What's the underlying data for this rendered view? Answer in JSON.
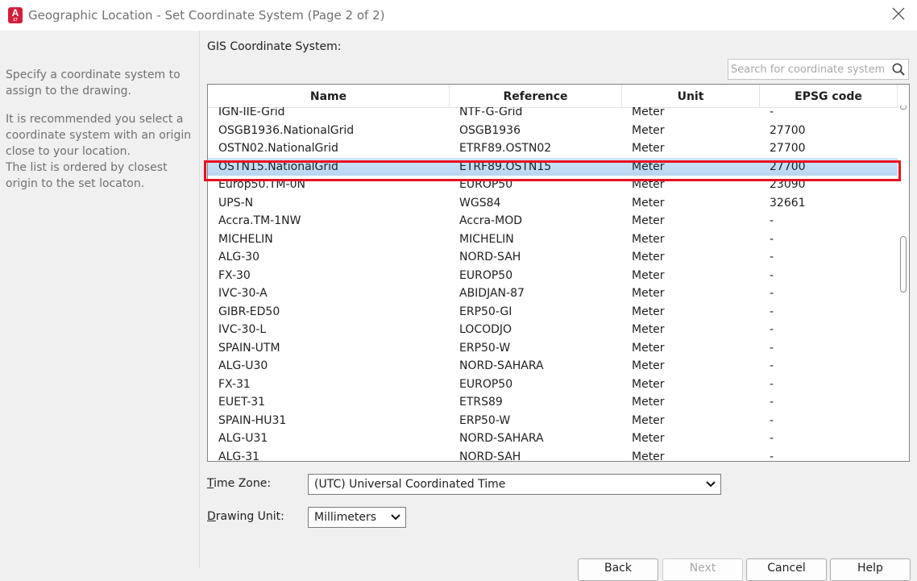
{
  "window": {
    "title": "Geographic Location - Set Coordinate System (Page 2 of 2)",
    "app_icon_letter": "A",
    "app_icon_sub": "17"
  },
  "help": {
    "p1": "Specify a coordinate system to assign to the drawing.",
    "p2": "It is recommended you select a coordinate system with an origin close to your location.",
    "p3": "The list is ordered by closest origin to the set locaton."
  },
  "gis": {
    "label": "GIS Coordinate System:",
    "search_placeholder": "Search for coordinate system"
  },
  "table": {
    "columns": [
      "Name",
      "Reference",
      "Unit",
      "EPSG code"
    ],
    "selected_index": 3,
    "rows": [
      [
        "IGN-IIE-Grid",
        "NTF-G-Grid",
        "Meter",
        "-"
      ],
      [
        "OSGB1936.NationalGrid",
        "OSGB1936",
        "Meter",
        "27700"
      ],
      [
        "OSTN02.NationalGrid",
        "ETRF89.OSTN02",
        "Meter",
        "27700"
      ],
      [
        "OSTN15.NationalGrid",
        "ETRF89.OSTN15",
        "Meter",
        "27700"
      ],
      [
        "Europ50.TM-0N",
        "EUROP50",
        "Meter",
        "23090"
      ],
      [
        "UPS-N",
        "WGS84",
        "Meter",
        "32661"
      ],
      [
        "Accra.TM-1NW",
        "Accra-MOD",
        "Meter",
        "-"
      ],
      [
        "MICHELIN",
        "MICHELIN",
        "Meter",
        "-"
      ],
      [
        "ALG-30",
        "NORD-SAH",
        "Meter",
        "-"
      ],
      [
        "FX-30",
        "EUROP50",
        "Meter",
        "-"
      ],
      [
        "IVC-30-A",
        "ABIDJAN-87",
        "Meter",
        "-"
      ],
      [
        "GIBR-ED50",
        "ERP50-GI",
        "Meter",
        "-"
      ],
      [
        "IVC-30-L",
        "LOCODJO",
        "Meter",
        "-"
      ],
      [
        "SPAIN-UTM",
        "ERP50-W",
        "Meter",
        "-"
      ],
      [
        "ALG-U30",
        "NORD-SAHARA",
        "Meter",
        "-"
      ],
      [
        "FX-31",
        "EUROP50",
        "Meter",
        "-"
      ],
      [
        "EUET-31",
        "ETRS89",
        "Meter",
        "-"
      ],
      [
        "SPAIN-HU31",
        "ERP50-W",
        "Meter",
        "-"
      ],
      [
        "ALG-U31",
        "NORD-SAHARA",
        "Meter",
        "-"
      ],
      [
        "ALG-31",
        "NORD-SAH",
        "Meter",
        "-"
      ]
    ]
  },
  "timezone": {
    "label_accel": "T",
    "label_rest": "ime Zone:",
    "value": "(UTC) Universal Coordinated Time"
  },
  "drawing_unit": {
    "label_accel": "D",
    "label_rest": "rawing Unit:",
    "value": "Millimeters"
  },
  "buttons": {
    "back": "Back",
    "next": "Next",
    "cancel": "Cancel",
    "help": "Help"
  },
  "colors": {
    "highlight_box": "#e81123",
    "selected_row": "#c3ddf5",
    "app_icon": "#d21f3c"
  }
}
